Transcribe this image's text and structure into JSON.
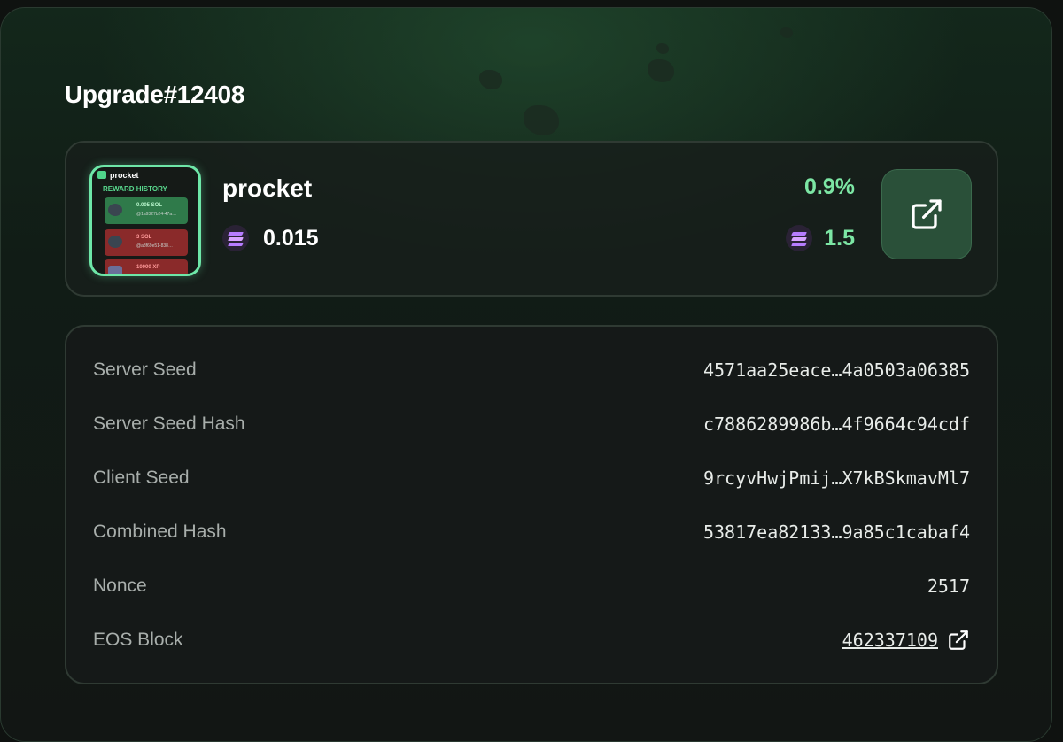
{
  "modal": {
    "title": "Upgrade#12408"
  },
  "item": {
    "name": "procket",
    "price": "0.015",
    "chance": "0.9%",
    "multiplier": "1.5",
    "currency_icon": "solana-icon",
    "open_icon": "external-link-icon",
    "thumbnail": {
      "brand": "procket",
      "heading": "REWARD HISTORY",
      "rows": [
        {
          "text": "0.005 SOL",
          "sub": "@1a9327b24-47a…",
          "color": "#2f7a4a"
        },
        {
          "text": "3 SOL",
          "sub": "@a8f69e51-838…",
          "color": "#8a2a2a"
        },
        {
          "text": "10000 XP",
          "sub": "",
          "color": "#8a2a2a"
        }
      ]
    }
  },
  "seeds": {
    "rows": [
      {
        "label": "Server Seed",
        "value": "4571aa25eace…4a0503a06385"
      },
      {
        "label": "Server Seed Hash",
        "value": "c7886289986b…4f9664c94cdf"
      },
      {
        "label": "Client Seed",
        "value": "9rcyvHwjPmij…X7kBSkmavMl7"
      },
      {
        "label": "Combined Hash",
        "value": "53817ea82133…9a85c1cabaf4"
      },
      {
        "label": "Nonce",
        "value": "2517"
      }
    ],
    "eos_block": {
      "label": "EOS Block",
      "value": "462337109",
      "icon": "external-link-icon"
    }
  },
  "colors": {
    "accent_green": "#7ce6a4",
    "button_bg": "#2a5039"
  }
}
